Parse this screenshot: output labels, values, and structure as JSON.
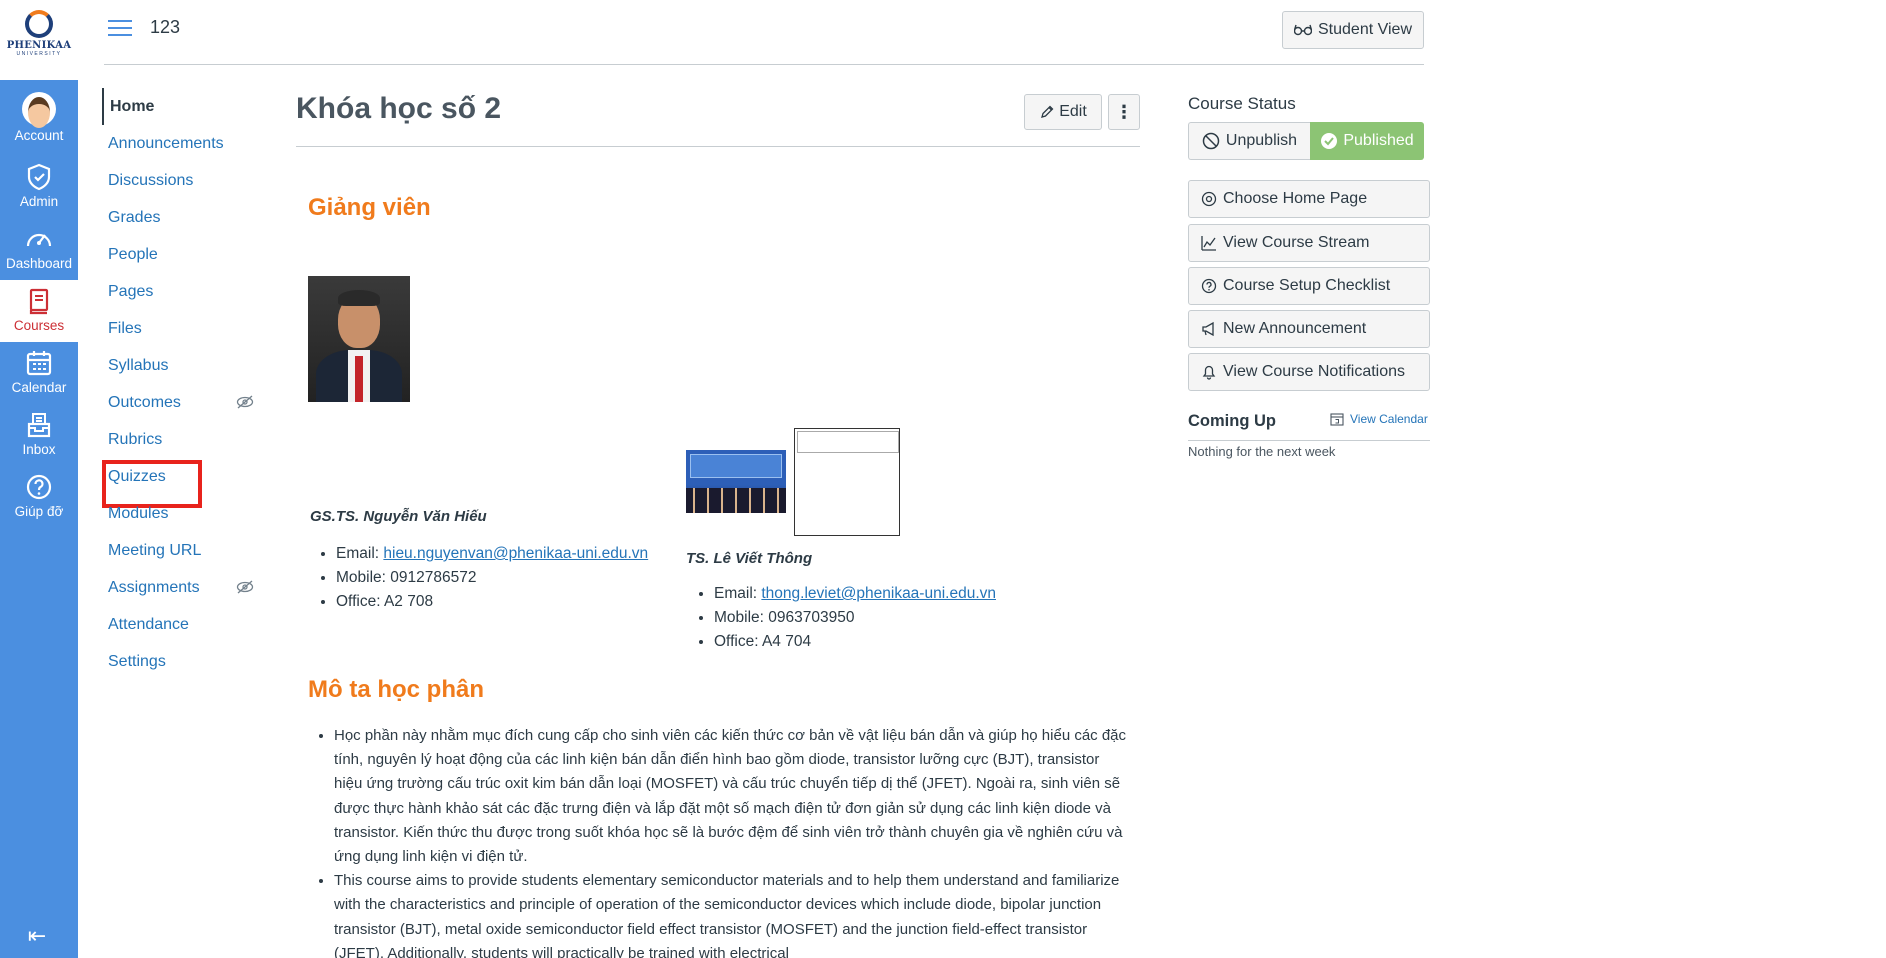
{
  "brand": {
    "name": "PHENIKAA",
    "sub": "UNIVERSITY",
    "nav_color": "#4b8fe0",
    "accent": "#f07b1c",
    "link": "#2474b8",
    "highlight": "#e8231c",
    "published": "#8cc474"
  },
  "global_nav": [
    {
      "label": "Account",
      "icon": "avatar-icon"
    },
    {
      "label": "Admin",
      "icon": "shield-icon"
    },
    {
      "label": "Dashboard",
      "icon": "speedometer-icon"
    },
    {
      "label": "Courses",
      "icon": "book-icon"
    },
    {
      "label": "Calendar",
      "icon": "calendar-icon"
    },
    {
      "label": "Inbox",
      "icon": "inbox-icon"
    },
    {
      "label": "Giúp đỡ",
      "icon": "help-icon"
    }
  ],
  "header": {
    "breadcrumb": "123",
    "student_view": "Student View"
  },
  "course_nav": [
    {
      "label": "Home"
    },
    {
      "label": "Announcements"
    },
    {
      "label": "Discussions"
    },
    {
      "label": "Grades"
    },
    {
      "label": "People"
    },
    {
      "label": "Pages"
    },
    {
      "label": "Files"
    },
    {
      "label": "Syllabus"
    },
    {
      "label": "Outcomes"
    },
    {
      "label": "Rubrics"
    },
    {
      "label": "Quizzes"
    },
    {
      "label": "Modules"
    },
    {
      "label": "Meeting URL"
    },
    {
      "label": "Assignments"
    },
    {
      "label": "Attendance"
    },
    {
      "label": "Settings"
    }
  ],
  "main": {
    "title": "Khóa học số 2",
    "edit_label": "Edit",
    "kebab": "⋮",
    "section_instructors": "Giảng viên",
    "instructor1": {
      "name": "GS.TS. Nguyễn Văn Hiếu",
      "email_prefix": "Email: ",
      "email": "hieu.nguyenvan@phenikaa-uni.edu.vn",
      "mobile": "Mobile: 0912786572",
      "office": "Office: A2 708"
    },
    "instructor2": {
      "name": "TS. Lê Viết Thông",
      "email_prefix": "Email: ",
      "email": "thong.leviet@phenikaa-uni.edu.vn",
      "mobile": "Mobile: 0963703950",
      "office": "Office: A4 704"
    },
    "section_description": "Mô ta học phân",
    "description": [
      "Học phần này nhằm mục đích cung cấp cho sinh viên các kiến thức cơ bản về vật liệu bán dẫn và giúp họ hiểu các đặc tính, nguyên lý hoạt động của các linh kiện bán dẫn điển hình bao gồm diode, transistor lưỡng cực (BJT), transistor hiệu ứng trường cấu trúc oxit kim bán dẫn loại (MOSFET) và cấu trúc chuyển tiếp dị thể (JFET). Ngoài ra, sinh viên sẽ được thực hành khảo sát các đặc trưng điện và lắp đặt một số mạch điện tử đơn giản sử dụng các linh kiện diode và transistor. Kiến thức thu được trong suốt khóa học sẽ là bước đệm để sinh viên trở thành chuyên gia về nghiên cứu và ứng dụng linh kiện vi điện tử.",
      "This course aims to provide students elementary semiconductor materials and to help them understand and familiarize with the characteristics and principle of operation of the semiconductor devices which include diode, bipolar junction transistor (BJT), metal oxide semiconductor field effect transistor (MOSFET) and the junction field-effect transistor (JFET). Additionally, students will practically be trained with electrical"
    ]
  },
  "sidebar": {
    "status_heading": "Course Status",
    "unpublish": "Unpublish",
    "published": "Published",
    "buttons": [
      {
        "label": "Choose Home Page",
        "icon": "target-icon"
      },
      {
        "label": "View Course Stream",
        "icon": "chart-icon"
      },
      {
        "label": "Course Setup Checklist",
        "icon": "question-circle-icon"
      },
      {
        "label": "New Announcement",
        "icon": "megaphone-icon"
      },
      {
        "label": "View Course Notifications",
        "icon": "bell-icon"
      }
    ],
    "coming_up": "Coming Up",
    "view_calendar": "View Calendar",
    "nothing": "Nothing for the next week"
  }
}
